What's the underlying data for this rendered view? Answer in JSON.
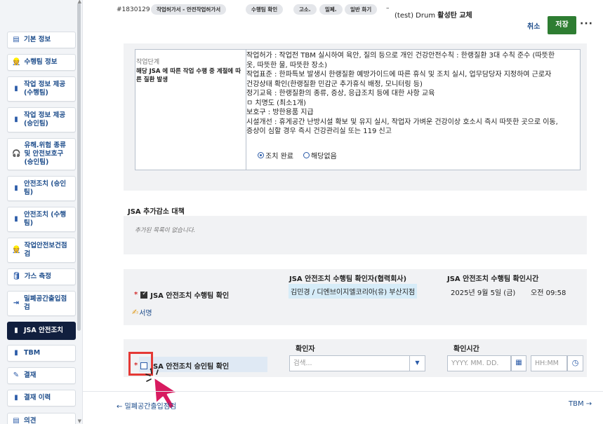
{
  "header": {
    "code": "#1830129",
    "tags": [
      "작업허가서 - 안전작업허가서",
      "수행팀 확인",
      "고소.",
      "밀폐.",
      "일반 화기"
    ],
    "dash": "–",
    "title_prefix": "(test) Drum",
    "title_main": "활성탄 교체",
    "cancel_label": "취소",
    "save_label": "저장",
    "more_label": "···"
  },
  "sidebar": {
    "items": [
      {
        "label": "기본 정보",
        "icon": "clipboard-icon",
        "glyph": "▤"
      },
      {
        "label": "수행팀 정보",
        "icon": "team-icon",
        "glyph": "👷"
      },
      {
        "label": "작업 정보 제공 (수행팀)",
        "icon": "document-icon",
        "glyph": "▮"
      },
      {
        "label": "작업 정보 제공 (승인팀)",
        "icon": "document-icon",
        "glyph": "▮"
      },
      {
        "label": "유해.위험 종류 및 안전보호구 (승인팀)",
        "icon": "headset-icon",
        "glyph": "🎧"
      },
      {
        "label": "안전조치 (승인팀)",
        "icon": "document-icon",
        "glyph": "▮"
      },
      {
        "label": "안전조치 (수행팀)",
        "icon": "document-icon",
        "glyph": "▮"
      },
      {
        "label": "작업안전보건점검",
        "icon": "worker-icon",
        "glyph": "👷"
      },
      {
        "label": "가스 측정",
        "icon": "gas-icon",
        "glyph": "🛢"
      },
      {
        "label": "밀폐공간출입점검",
        "icon": "entry-icon",
        "glyph": "⇥"
      },
      {
        "label": "JSA 안전조치",
        "icon": "document-icon",
        "glyph": "▮"
      },
      {
        "label": "TBM",
        "icon": "document-icon",
        "glyph": "▮"
      },
      {
        "label": "결재",
        "icon": "pen-icon",
        "glyph": "✎"
      },
      {
        "label": "결재 이력",
        "icon": "document-icon",
        "glyph": "▮"
      },
      {
        "label": "의견",
        "icon": "comment-icon",
        "glyph": "▤"
      }
    ]
  },
  "jsa_step": {
    "stage_label": "작업단계",
    "stage_desc": "해당 JSA 에 따른 작업 수행 중 계절에 따른 질환 발생",
    "measures": [
      "작업허가 : 작업전 TBM 실시하여 육안, 질의 등으로 개인 건강안전수칙 : 한랭질환 3대 수칙 준수 (따뜻한",
      "옷, 따뜻한 물, 따뜻한 장소)",
      "작업표준 : 한파특보 발생시 한랭질환 예방가이드에 따른 휴식 및 조치 실시, 업무담당자 지정하여 근로자",
      "건강상태 확인(한랭질환 민감군 추가휴식 배정, 모니터링 등)",
      "정기교육 : 한랭질환의 종류, 증상, 응급조치 등에 대한 사항 교육",
      "ㅁ 치명도 (최소1개)",
      "보호구 : 방한용품 지급",
      "시설개선 : 휴게공간 난방시설 확보 및 유지 실시, 작업자 가벼운 건강이상 호소시 즉시 따뜻한 곳으로 이동,",
      "증상이 심할 경우 즉시 건강관리실 또는 119 신고"
    ],
    "radio_done": "조치 완료",
    "radio_na": "해당없음"
  },
  "additional": {
    "title": "JSA 추가감소 대책",
    "empty": "추가된 목록이 없습니다."
  },
  "performer": {
    "col_name": "JSA 안전조치 수행팀 확인자(협력회사)",
    "col_time": "JSA 안전조치 수행팀 확인시간",
    "req": "*",
    "label": "JSA 안전조치 수행팀 확인",
    "name_value": "김민경 / 디엔브이지엘코리아(유) 부산지점",
    "date_value": "2025년 9월 5일 (금)",
    "time_value": "오전 09:58",
    "sign_label": "서명"
  },
  "approver": {
    "col_name": "확인자",
    "col_time": "확인시간",
    "req": "*",
    "label": "JSA 안전조치 승인팀 확인",
    "search_placeholder": "검색...",
    "date_placeholder": "YYYY. MM. DD.",
    "time_placeholder": "HH:MM"
  },
  "footer": {
    "prev": "← 밀폐공간출입점검",
    "next": "TBM →"
  },
  "colors": {
    "save": "#2e7d32",
    "active_nav": "#111f3e",
    "accent": "#1f4e8c",
    "highlight": "#e53935",
    "cursor": "#d81b60"
  }
}
